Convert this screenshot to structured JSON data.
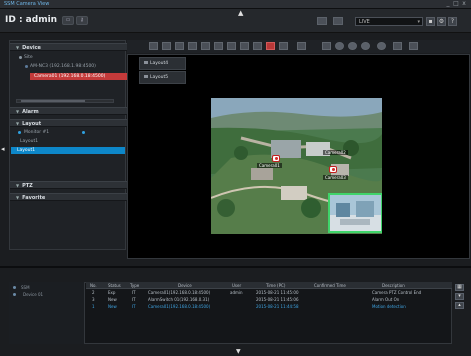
{
  "window": {
    "title": "SSM Camera View",
    "minimize": "_",
    "maximize": "□",
    "close": "x"
  },
  "header": {
    "id_label": "ID : admin",
    "btn_a": "",
    "btn_b": "",
    "context_value": "LIVE",
    "context_caret": "▾",
    "collapse_glyph": "▲"
  },
  "left_panel": {
    "sections": {
      "device": "Device",
      "alarm": "Alarm",
      "layout": "Layout",
      "ptz": "PTZ",
      "favorite": "Favorite"
    },
    "device_tree": [
      "Site",
      "AM-NC3 (192.168.1.98:4500)",
      "Camera01 (192.168.0.18:4500)"
    ],
    "layout_tree": [
      "Monitor #1",
      "Layout1",
      "Layout1"
    ]
  },
  "view": {
    "tabs": [
      "Layout4",
      "Layout5"
    ],
    "camera_labels": [
      "Camera01",
      "Camera02",
      "Camera03"
    ]
  },
  "events": {
    "tree": [
      "SSM",
      "Device 01"
    ],
    "columns": [
      "No.",
      "Status",
      "Type",
      "Device",
      "User",
      "Time (PC)",
      "Confirmed Time",
      "Description"
    ],
    "rows": [
      {
        "no": "2",
        "status": "Exp",
        "type": "IT",
        "device": "Camera01(192.168.0.18:4500)",
        "user": "admin",
        "time": "2015-08-21 11:45:00",
        "confirmed": "",
        "desc": "Camera PTZ Control End",
        "style": "normal"
      },
      {
        "no": "3",
        "status": "New",
        "type": "IT",
        "device": "AlarmSwitch 01(192.168.0.31)",
        "user": "",
        "time": "2015-08-21 11:45:06",
        "confirmed": "",
        "desc": "Alarm Out On",
        "style": "normal"
      },
      {
        "no": "1",
        "status": "New",
        "type": "IT",
        "device": "Camera01(192.168.0.18:4500)",
        "user": "",
        "time": "2015-08-21 11:44:58",
        "confirmed": "",
        "desc": "Motion detection",
        "style": "blue"
      }
    ],
    "right_buttons": [
      "▦",
      "▾",
      "▴"
    ]
  },
  "footer": {
    "expand_glyph": "▼"
  },
  "side_toggle": "◂",
  "colors": {
    "accent_blue": "#0d87c9",
    "selection_red": "#c43a3a",
    "pip_border": "#3fd46a"
  }
}
